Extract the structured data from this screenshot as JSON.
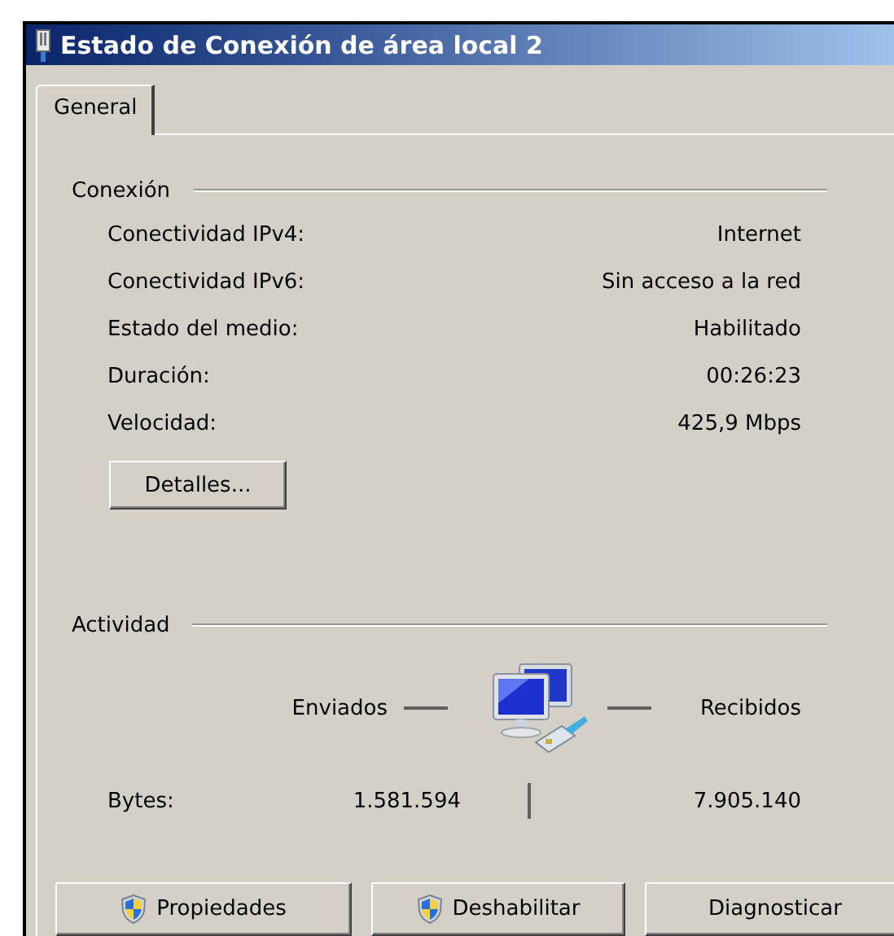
{
  "window": {
    "title": "Estado de Conexión de área local 2"
  },
  "tabs": [
    {
      "label": "General",
      "selected": true
    }
  ],
  "connection": {
    "heading": "Conexión",
    "rows": [
      {
        "label": "Conectividad IPv4:",
        "value": "Internet"
      },
      {
        "label": "Conectividad IPv6:",
        "value": "Sin acceso a la red"
      },
      {
        "label": "Estado del medio:",
        "value": "Habilitado"
      },
      {
        "label": "Duración:",
        "value": "00:26:23"
      },
      {
        "label": "Velocidad:",
        "value": "425,9 Mbps"
      }
    ],
    "details_button": "Detalles..."
  },
  "activity": {
    "heading": "Actividad",
    "sent_label": "Enviados",
    "received_label": "Recibidos",
    "bytes_label": "Bytes:",
    "bytes_sent": "1.581.594",
    "bytes_received": "7.905.140"
  },
  "buttons": [
    {
      "label": "Propiedades",
      "shield": true
    },
    {
      "label": "Deshabilitar",
      "shield": true
    },
    {
      "label": "Diagnosticar",
      "shield": false
    }
  ]
}
